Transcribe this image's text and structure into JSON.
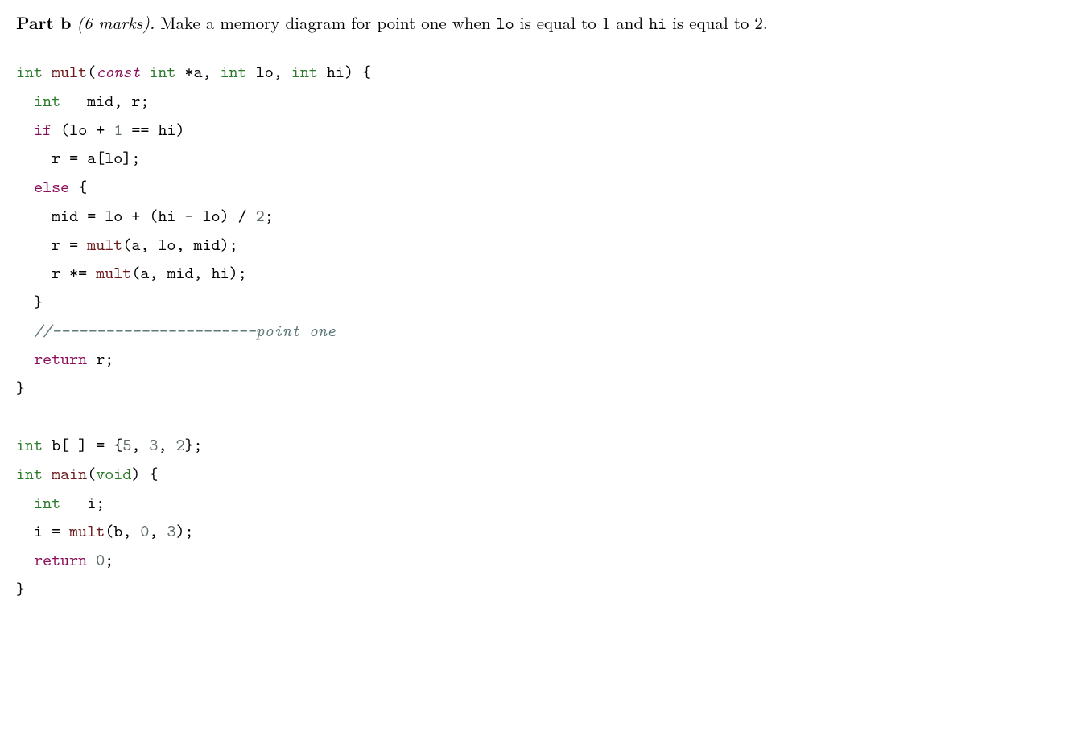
{
  "prompt": {
    "part_label": "Part b",
    "marks": "(6 marks).",
    "text_before_lo": " Make a memory diagram for point one when ",
    "tt_lo": "lo",
    "text_mid": " is equal to 1 and ",
    "tt_hi": "hi",
    "text_after_hi": " is equal to 2."
  },
  "code": {
    "tokens": {
      "int": "int",
      "const": "const",
      "void": "void",
      "if": "if",
      "else": "else",
      "return": "return",
      "mult": "mult",
      "main": "main"
    },
    "l1_sig_part1": " *a, ",
    "l1_sig_part2": " lo, ",
    "l1_sig_part3": " hi) {",
    "l2": "   mid, r;",
    "l3_cond": " (lo + ",
    "l3_num1": "1",
    "l3_after": " == hi)",
    "l4": "    r = a[lo];",
    "l5_brace": " {",
    "l6_a": "    mid = lo + (hi - lo) / ",
    "l6_num2": "2",
    "l6_semi": ";",
    "l7_a": "    r = ",
    "l7_args": "(a, lo, mid);",
    "l8_a": "    r *= ",
    "l8_args": "(a, mid, hi);",
    "l9": "  }",
    "l10_comment": "  //-----------------------point one",
    "l11_ret": " r;",
    "l12": "}",
    "blank": "",
    "l14_a": " b[ ] = {",
    "l14_n1": "5",
    "l14_n2": "3",
    "l14_n3": "2",
    "l14_close": "};",
    "comma_sp": ", ",
    "l15_sig": ") {",
    "l16": "   i;",
    "l17_a": "  i = ",
    "l17_args_open": "(b, ",
    "l17_n0": "0",
    "l17_n3": "3",
    "l17_close": ");",
    "l18_ret_sp": " ",
    "l18_num0": "0",
    "l18_semi": ";",
    "l19": "}",
    "open_paren": "(",
    "sp2": "  ",
    "sp4": "    "
  }
}
